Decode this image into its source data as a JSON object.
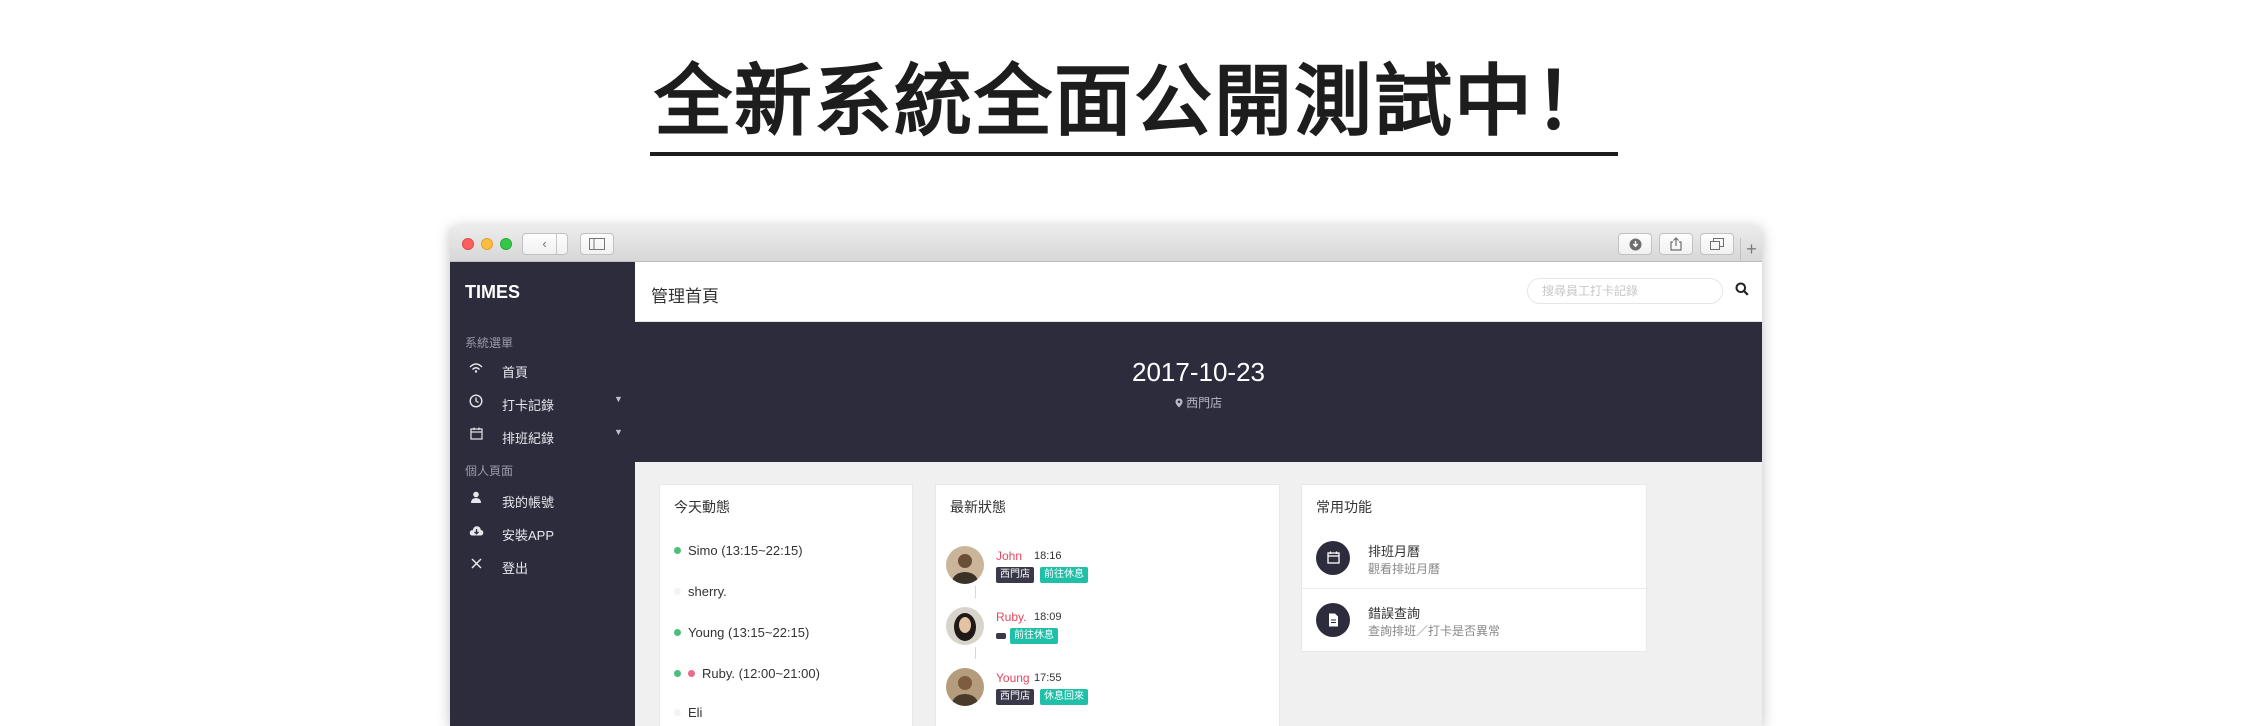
{
  "headline": "全新系統全面公開測試中！",
  "browser": {
    "back_glyph": "‹",
    "forward_glyph": "›",
    "new_tab_glyph": "+"
  },
  "sidebar": {
    "brand": "TIMES",
    "section_menu": "系統選單",
    "section_personal": "個人頁面",
    "items": [
      {
        "label": "首頁",
        "icon": "wifi-icon"
      },
      {
        "label": "打卡記錄",
        "icon": "clock-icon"
      },
      {
        "label": "排班紀錄",
        "icon": "calendar-icon"
      },
      {
        "label": "我的帳號",
        "icon": "user-icon"
      },
      {
        "label": "安裝APP",
        "icon": "cloud-download-icon"
      },
      {
        "label": "登出",
        "icon": "close-icon"
      }
    ]
  },
  "topbar": {
    "title": "管理首頁",
    "search_placeholder": "搜尋員工打卡記錄"
  },
  "hero": {
    "date": "2017-10-23",
    "location": "西門店"
  },
  "today": {
    "title": "今天動態",
    "rows": [
      {
        "text": "Simo (13:15~22:15)",
        "dot": "#4cc07a"
      },
      {
        "text": "sherry.",
        "dot": "#f3f3f3"
      },
      {
        "text": "Young (13:15~22:15)",
        "dot": "#4cc07a"
      },
      {
        "text": "Ruby. (12:00~21:00)",
        "dot": "#4cc07a",
        "dot2": "#ee6a8a"
      },
      {
        "text": "Eli",
        "dot": "#f3f3f3"
      }
    ]
  },
  "status": {
    "title": "最新狀態",
    "rows": [
      {
        "name": "John",
        "time": "18:16",
        "tags": [
          "西門店",
          "前往休息"
        ]
      },
      {
        "name": "Ruby.",
        "time": "18:09",
        "tags": [
          "",
          "前往休息"
        ]
      },
      {
        "name": "Young",
        "time": "17:55",
        "tags": [
          "西門店",
          "休息回來"
        ]
      }
    ]
  },
  "functions": {
    "title": "常用功能",
    "items": [
      {
        "title": "排班月曆",
        "subtitle": "觀看排班月曆",
        "icon": "calendar-icon"
      },
      {
        "title": "錯誤查詢",
        "subtitle": "查詢排班／打卡是否異常",
        "icon": "document-icon"
      }
    ]
  },
  "colors": {
    "sidebar_bg": "#2d2c3c",
    "accent_red": "#e8455e",
    "accent_teal": "#1fbfa8"
  }
}
